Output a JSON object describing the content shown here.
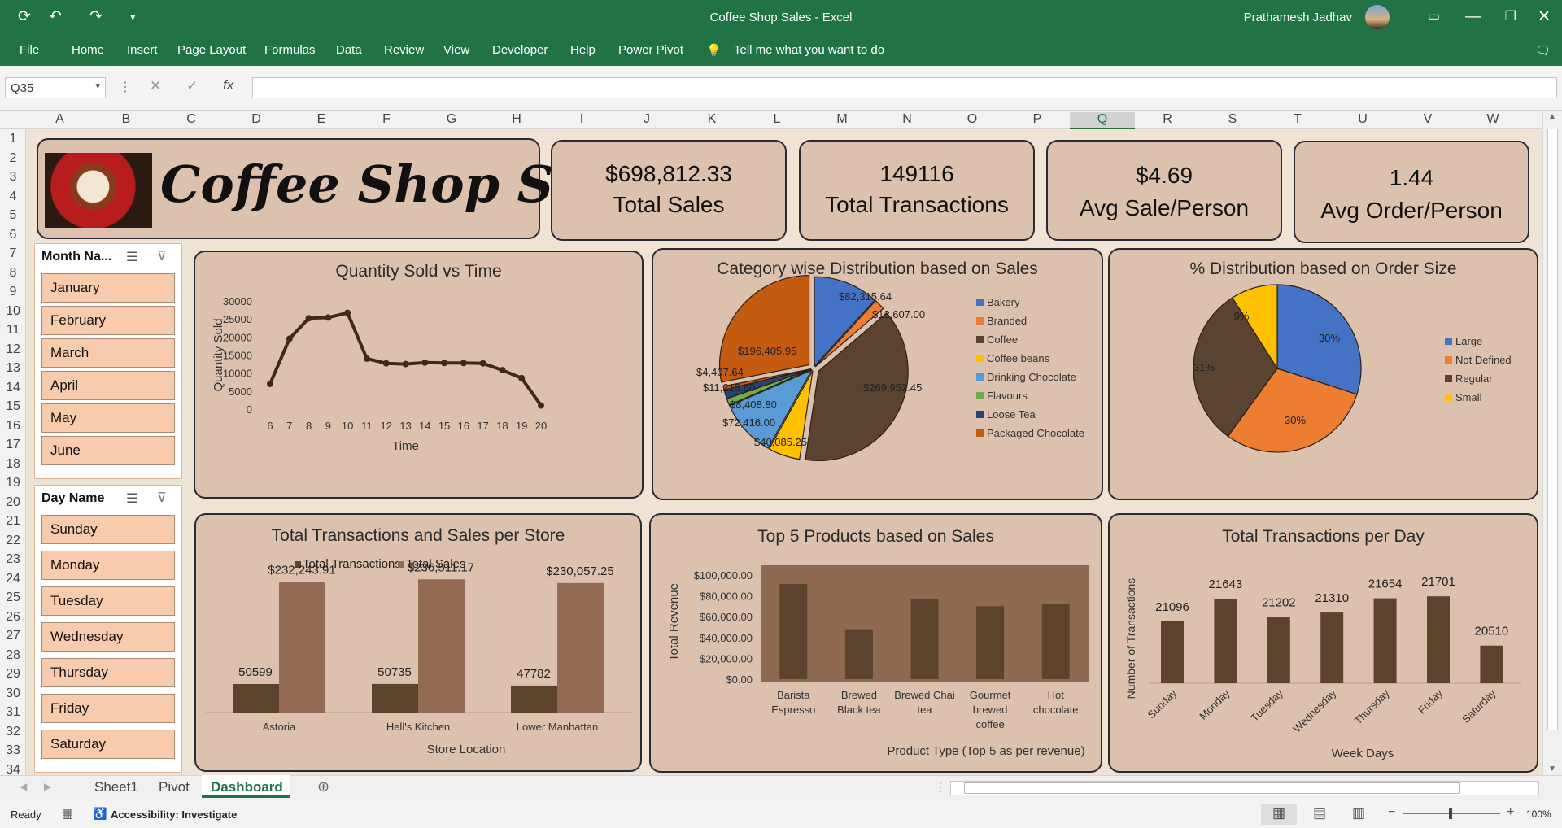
{
  "window": {
    "title": "Coffee Shop Sales  -  Excel",
    "user": "Prathamesh Jadhav"
  },
  "ribbon": {
    "menus": [
      "File",
      "Home",
      "Insert",
      "Page Layout",
      "Formulas",
      "Data",
      "Review",
      "View",
      "Developer",
      "Help",
      "Power Pivot"
    ],
    "tell_me": "Tell me what you want to do"
  },
  "formula_bar": {
    "name_box": "Q35",
    "fx": "fx",
    "content": ""
  },
  "grid": {
    "columns": [
      "A",
      "B",
      "C",
      "D",
      "E",
      "F",
      "G",
      "H",
      "I",
      "J",
      "K",
      "L",
      "M",
      "N",
      "O",
      "P",
      "Q",
      "R",
      "S",
      "T",
      "U",
      "V",
      "W"
    ],
    "rows": [
      "1",
      "2",
      "3",
      "4",
      "5",
      "6",
      "7",
      "8",
      "9",
      "10",
      "11",
      "12",
      "13",
      "14",
      "15",
      "16",
      "17",
      "18",
      "19",
      "20",
      "21",
      "22",
      "23",
      "24",
      "25",
      "26",
      "27",
      "28",
      "29",
      "30",
      "31",
      "32",
      "33",
      "34"
    ],
    "selected_column": "Q"
  },
  "dashboard": {
    "title": "Coffee Shop Sales",
    "kpis": [
      {
        "value": "$698,812.33",
        "label": "Total Sales"
      },
      {
        "value": "149116",
        "label": "Total Transactions"
      },
      {
        "value": "$4.69",
        "label": "Avg Sale/Person"
      },
      {
        "value": "1.44",
        "label": "Avg Order/Person"
      }
    ],
    "month_slicer": {
      "title": "Month Na...",
      "items": [
        "January",
        "February",
        "March",
        "April",
        "May",
        "June"
      ]
    },
    "day_slicer": {
      "title": "Day Name",
      "items": [
        "Sunday",
        "Monday",
        "Tuesday",
        "Wednesday",
        "Thursday",
        "Friday",
        "Saturday"
      ]
    },
    "colors": {
      "dark_brown": "#3f2a1a",
      "medium_brown": "#936b55",
      "card_bg": "#dcc1ae",
      "plot_bg": "#8e6a52",
      "bar": "#5c432e",
      "blue": "#4472c4",
      "orange": "#ed7d31",
      "coffee": "#5a4330",
      "yellow": "#ffc000",
      "light_blue": "#5b9bd5",
      "green": "#70ad47",
      "navy": "#264478",
      "rust": "#c55a11"
    }
  },
  "chart_data": [
    {
      "type": "line",
      "title": "Quantity Sold vs Time",
      "xlabel": "Time",
      "ylabel": "Quantity Sold",
      "x": [
        6,
        7,
        8,
        9,
        10,
        11,
        12,
        13,
        14,
        15,
        16,
        17,
        18,
        19,
        20
      ],
      "values": [
        7000,
        19500,
        25200,
        25400,
        26700,
        14000,
        12700,
        12500,
        12900,
        12800,
        12800,
        12700,
        10800,
        8600,
        1000
      ],
      "ylim": [
        0,
        30000
      ],
      "yticks": [
        "0",
        "5000",
        "10000",
        "15000",
        "20000",
        "25000",
        "30000"
      ]
    },
    {
      "type": "pie",
      "title": "Category wise Distribution based on Sales",
      "categories": [
        "Bakery",
        "Branded",
        "Coffee",
        "Coffee beans",
        "Drinking Chocolate",
        "Flavours",
        "Loose Tea",
        "Packaged Chocolate"
      ],
      "values": [
        82315.64,
        13607.0,
        269952.45,
        40085.25,
        72416.0,
        8408.8,
        11213.6,
        4407.64
      ],
      "labels": [
        "$82,315.64",
        "$13,607.00",
        "$269,952.45",
        "$40,085.25",
        "$72,416.00",
        "$8,408.80",
        "$11,213.60",
        "$4,407.64"
      ],
      "extra_label": "$196,405.95",
      "legend": "right"
    },
    {
      "type": "pie",
      "title": "% Distribution based on Order Size",
      "categories": [
        "Large",
        "Not Defined",
        "Regular",
        "Small"
      ],
      "values": [
        30,
        30,
        31,
        9
      ],
      "labels": [
        "30%",
        "30%",
        "31%",
        "9%"
      ],
      "legend": "right"
    },
    {
      "type": "bar",
      "title": "Total Transactions and Sales per Store",
      "xlabel": "Store Location",
      "categories": [
        "Astoria",
        "Hell's Kitchen",
        "Lower Manhattan"
      ],
      "series": [
        {
          "name": "Total Transactions",
          "values": [
            50599,
            50735,
            47782
          ],
          "labels": [
            "50599",
            "50735",
            "47782"
          ]
        },
        {
          "name": "Total Sales",
          "values": [
            232243.91,
            236511.17,
            230057.25
          ],
          "labels": [
            "$232,243.91",
            "$236,511.17",
            "$230,057.25"
          ]
        }
      ],
      "legend": "top"
    },
    {
      "type": "bar",
      "title": "Top 5 Products based on Sales",
      "xlabel": "Product Type (Top 5 as per revenue)",
      "ylabel": "Total Revenue",
      "categories": [
        "Barista Espresso",
        "Brewed Black tea",
        "Brewed Chai tea",
        "Gourmet brewed coffee",
        "Hot chocolate"
      ],
      "category_lines": [
        [
          "Barista",
          "Espresso"
        ],
        [
          "Brewed",
          "Black tea"
        ],
        [
          "Brewed Chai",
          "tea"
        ],
        [
          "Gourmet",
          "brewed",
          "coffee"
        ],
        [
          "Hot",
          "chocolate"
        ]
      ],
      "values": [
        91400,
        47900,
        77100,
        70000,
        72400
      ],
      "ylim": [
        0,
        100000
      ],
      "yticks": [
        "$0.00",
        "$20,000.00",
        "$40,000.00",
        "$60,000.00",
        "$80,000.00",
        "$100,000.00"
      ]
    },
    {
      "type": "bar",
      "title": "Total Transactions per Day",
      "xlabel": "Week Days",
      "ylabel": "Number of Transactions",
      "categories": [
        "Sunday",
        "Monday",
        "Tuesday",
        "Wednesday",
        "Thursday",
        "Friday",
        "Saturday"
      ],
      "values": [
        21096,
        21643,
        21202,
        21310,
        21654,
        21701,
        20510
      ],
      "labels": [
        "21096",
        "21643",
        "21202",
        "21310",
        "21654",
        "21701",
        "20510"
      ]
    }
  ],
  "sheet_tabs": {
    "tabs": [
      "Sheet1",
      "Pivot",
      "Dashboard"
    ],
    "active": "Dashboard"
  },
  "status": {
    "ready": "Ready",
    "accessibility": "Accessibility: Investigate",
    "zoom": "100%"
  }
}
